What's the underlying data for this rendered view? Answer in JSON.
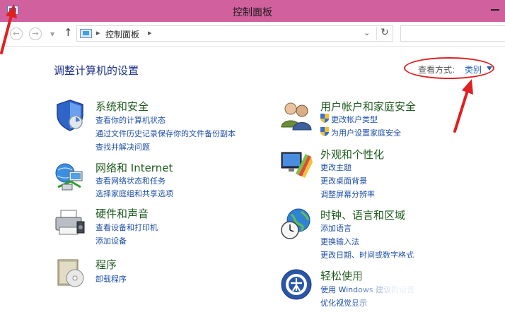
{
  "window": {
    "title": "控制面板"
  },
  "address_bar": {
    "back_glyph": "←",
    "forward_glyph": "→",
    "up_glyph": "↑",
    "separator": "▸",
    "crumb": "控制面板",
    "dropdown_glyph": "⌄",
    "refresh_glyph": "↻"
  },
  "main": {
    "heading": "调整计算机的设置",
    "view_by_label": "查看方式:",
    "view_by_value": "类别"
  },
  "categories": {
    "system_security": {
      "title": "系统和安全",
      "links": [
        "查看你的计算机状态",
        "通过文件历史记录保存你的文件备份副本",
        "查找并解决问题"
      ]
    },
    "network_internet": {
      "title": "网络和 Internet",
      "links": [
        "查看网络状态和任务",
        "选择家庭组和共享选项"
      ]
    },
    "hardware_sound": {
      "title": "硬件和声音",
      "links": [
        "查看设备和打印机",
        "添加设备"
      ]
    },
    "programs": {
      "title": "程序",
      "links": [
        "卸载程序"
      ]
    },
    "user_accounts": {
      "title": "用户帐户和家庭安全",
      "links": [
        "更改帐户类型",
        "为用户设置家庭安全"
      ]
    },
    "appearance": {
      "title": "外观和个性化",
      "links": [
        "更改主题",
        "更改桌面背景",
        "调整屏幕分辨率"
      ]
    },
    "clock_region": {
      "title": "时钟、语言和区域",
      "links": [
        "添加语言",
        "更换输入法",
        "更改日期、时间或数字格式"
      ]
    },
    "ease_of_access": {
      "title": "轻松使用",
      "links": [
        "使用 Windows 建议的设置",
        "优化视觉显示"
      ]
    }
  },
  "colors": {
    "titlebar": "#d1609e",
    "heading": "#1e3287",
    "category_title": "#1e5a1e",
    "link": "#1f4fa8",
    "annotation": "#e02020"
  },
  "icons": [
    "app-icon",
    "back-icon",
    "forward-icon",
    "up-icon",
    "control-panel-icon",
    "refresh-icon",
    "shield-icon",
    "network-icon",
    "printer-icon",
    "programs-icon",
    "users-icon",
    "appearance-icon",
    "globe-clock-icon",
    "ease-access-icon"
  ]
}
